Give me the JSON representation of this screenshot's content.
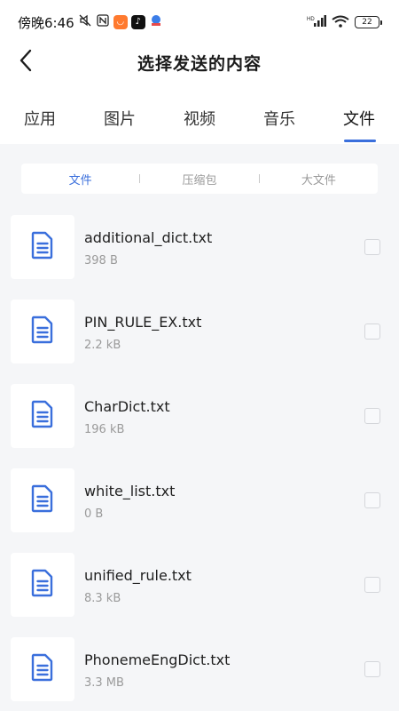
{
  "status_bar": {
    "carrier_time": "傍晚6:46",
    "hd_label": "HD",
    "battery": "22"
  },
  "header": {
    "title": "选择发送的内容",
    "back_icon": "chevron-left-icon"
  },
  "tabs": [
    {
      "label": "应用"
    },
    {
      "label": "图片"
    },
    {
      "label": "视频"
    },
    {
      "label": "音乐"
    },
    {
      "label": "文件"
    }
  ],
  "active_tab": "文件",
  "segments": [
    {
      "label": "文件"
    },
    {
      "label": "压缩包"
    },
    {
      "label": "大文件"
    }
  ],
  "active_segment": "文件",
  "files": [
    {
      "name": "additional_dict.txt",
      "size": "398 B"
    },
    {
      "name": "PIN_RULE_EX.txt",
      "size": "2.2 kB"
    },
    {
      "name": "CharDict.txt",
      "size": "196 kB"
    },
    {
      "name": "white_list.txt",
      "size": "0 B"
    },
    {
      "name": "unified_rule.txt",
      "size": "8.3 kB"
    },
    {
      "name": "PhonemeEngDict.txt",
      "size": "3.3 MB"
    }
  ],
  "colors": {
    "accent": "#3a6fdc",
    "background": "#f5f6f8",
    "file_icon": "#3a6fdc"
  }
}
